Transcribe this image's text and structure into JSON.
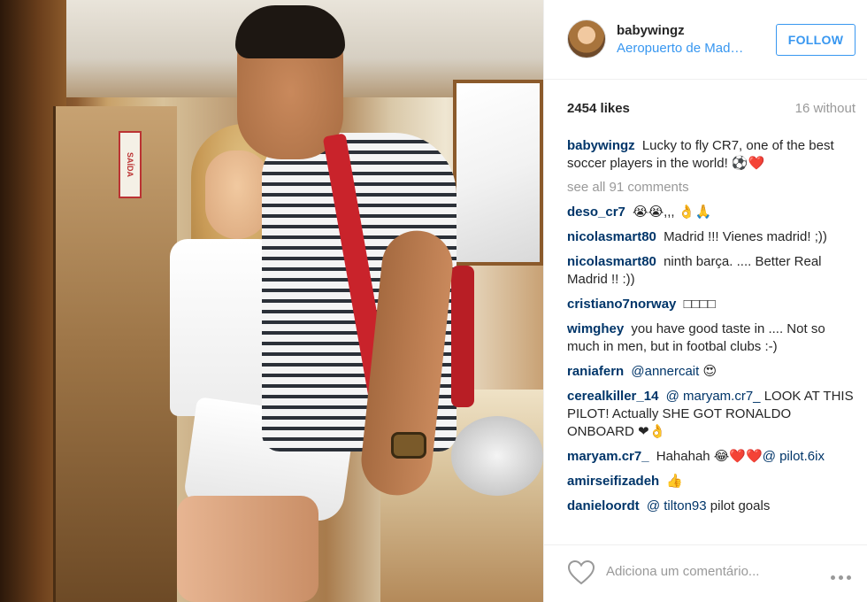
{
  "photo": {
    "exit_sign": "SAÍDA"
  },
  "header": {
    "username": "babywingz",
    "location": "Aeropuerto de Mad…",
    "follow_label": "FOLLOW"
  },
  "stats": {
    "likes": "2454 likes",
    "time": "16 without"
  },
  "caption": {
    "author": "babywingz",
    "text": "Lucky to fly CR7, one of the best soccer players in the world! ⚽❤️"
  },
  "see_all": "see all 91 comments",
  "comments": [
    {
      "author": "deso_cr7",
      "text": "😭😭,,, 👌🙏"
    },
    {
      "author": "nicolasmart80",
      "text": "Madrid !!! Vienes madrid! ;))"
    },
    {
      "author": "nicolasmart80",
      "text": "ninth barça. .... Better Real Madrid !! :))"
    },
    {
      "author": "cristiano7norway",
      "text": "□□□□"
    },
    {
      "author": "wimghey",
      "text": "you have good taste in .... Not so much in men, but in footbal clubs :-)"
    },
    {
      "author": "raniafern",
      "mention": "@annercait",
      "text": "😍"
    },
    {
      "author": "cerealkiller_14",
      "mention": "@ maryam.cr7_",
      "text": "LOOK AT THIS PILOT! Actually SHE GOT RONALDO ONBOARD ❤👌"
    },
    {
      "author": "maryam.cr7_",
      "text": "Hahahah 😂❤️❤️",
      "mention": "@ pilot.6ix"
    },
    {
      "author": "amirseifizadeh",
      "text": "👍"
    },
    {
      "author": "danieloordt",
      "mention": "@ tilton93",
      "text": "pilot goals"
    }
  ],
  "add_comment": {
    "placeholder": "Adiciona um comentário..."
  },
  "colors": {
    "accent": "#3897f0",
    "author": "#003569",
    "muted": "#999999"
  }
}
